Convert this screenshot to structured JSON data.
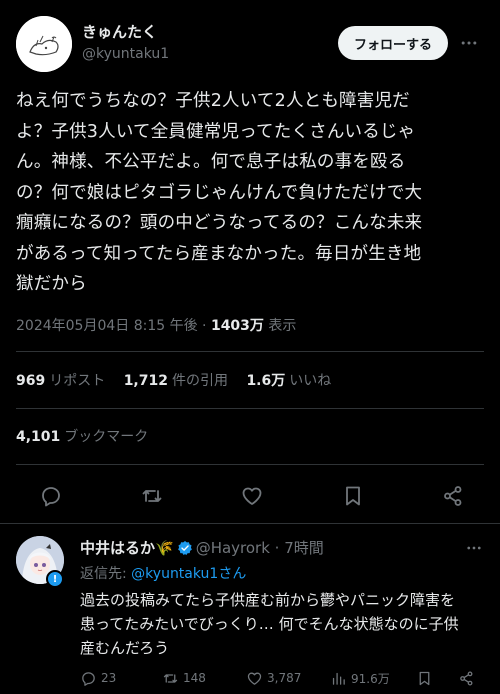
{
  "post": {
    "display_name": "きゅんたく",
    "handle": "@kyuntaku1",
    "follow_label": "フォローする",
    "body_lines": [
      "ねえ何でうちなの？子供2人いて2人とも障害児だ",
      "よ？子供3人いて全員健常児ってたくさんいるじゃ",
      "ん。神様、不公平だよ。何で息子は私の事を殴る",
      "の？何で娘はピタゴラじゃんけんで負けただけで大",
      "癇癪になるの？頭の中どうなってるの？こんな未来",
      "があるって知ってたら産まなかった。毎日が生き地",
      "獄だから"
    ],
    "timestamp": "2024年05月04日 8:15 午後 · ",
    "views_count": "1403万",
    "views_label": " 表示",
    "stats": {
      "reposts_count": "969",
      "reposts_label": "リポスト",
      "quotes_count": "1,712",
      "quotes_label": "件の引用",
      "likes_count": "1.6万",
      "likes_label": "いいね",
      "bookmarks_count": "4,101",
      "bookmarks_label": "ブックマーク"
    },
    "actions": [
      "reply-icon",
      "repost-icon",
      "like-icon",
      "bookmark-icon",
      "share-icon"
    ]
  },
  "reply": {
    "display_name": "中井はるか🌾",
    "handle": "@Hayrork",
    "time": " · 7時間",
    "reply_to_prefix": "返信先: ",
    "reply_to_handle": "@kyuntaku1さん",
    "text_lines": [
      "過去の投稿みてたら子供産む前から鬱やパニック障害を",
      "患ってたみたいでびっくり… 何でそんな状態なのに子供",
      "産むんだろう"
    ],
    "replies_count": "23",
    "reposts_count": "148",
    "likes_count": "3,787",
    "views_count": "91.6万",
    "badge_symbol": "!"
  },
  "colors": {
    "background": "#000000",
    "text": "#e7e9ea",
    "muted": "#71767b",
    "accent": "#1d9bf0",
    "divider": "#2f3336"
  }
}
